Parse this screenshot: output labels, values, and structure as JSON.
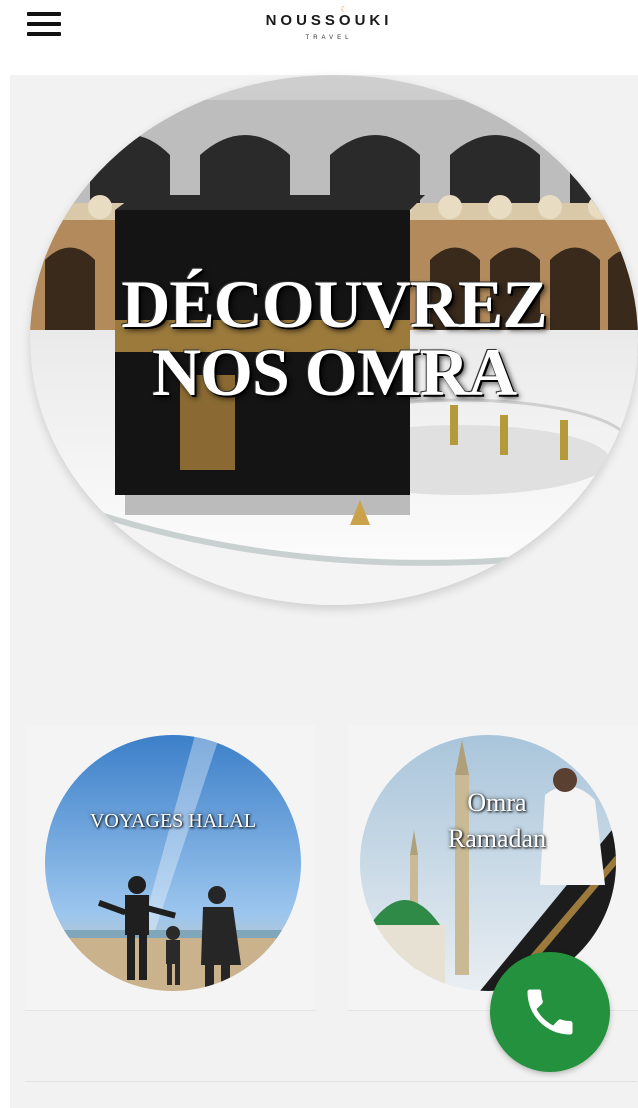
{
  "header": {
    "menu_icon": "hamburger-menu-icon",
    "logo_main": "NOUSSOUKI",
    "logo_sub": "TRAVEL",
    "logo_accent_color": "#d1a02a"
  },
  "hero": {
    "title_line1": "DÉCOUVREZ",
    "title_line2": "NOS OMRA"
  },
  "cards": [
    {
      "label": "VOYAGES HALAL"
    },
    {
      "label_line1": "Omra",
      "label_line2": "Ramadan"
    }
  ],
  "call_button": {
    "icon": "phone-icon",
    "color": "#23913d"
  },
  "colors": {
    "background": "#f2f2f2",
    "header_bg": "#ffffff"
  }
}
